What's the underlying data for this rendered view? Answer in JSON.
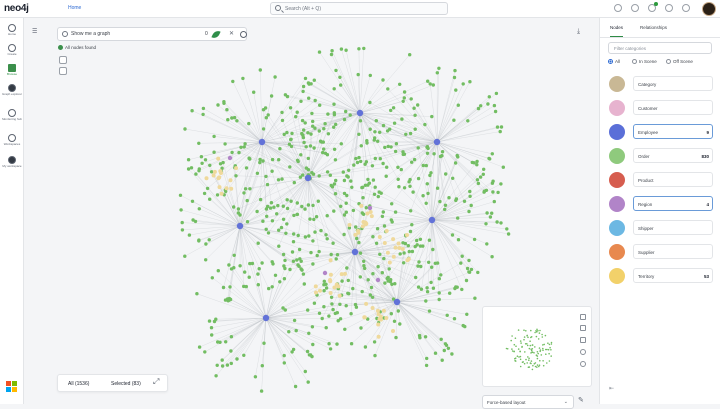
{
  "topbar": {
    "logo": "neo4j",
    "home": "Home",
    "search_placeholder": "Search (Alt + Q)",
    "icons": [
      "question-icon",
      "sync-icon",
      "bell-icon",
      "settings-icon",
      "help-icon"
    ]
  },
  "nav": {
    "items": [
      {
        "label": "Home",
        "icon": "home-icon"
      },
      {
        "label": "Create",
        "icon": "plus-icon"
      },
      {
        "label": "Browse",
        "icon": "folder-icon"
      },
      {
        "label": "Graph explorer",
        "icon": "graph-icon"
      },
      {
        "label": "Monitoring hub",
        "icon": "monitor-icon"
      },
      {
        "label": "Workspaces",
        "icon": "workspace-icon"
      },
      {
        "label": "My workspace",
        "icon": "avatar-icon"
      }
    ]
  },
  "toolbar": {
    "nl_query": "Show me a graph",
    "nl_count": "0",
    "found": "All nodes found"
  },
  "bottom": {
    "all": "All (1536)",
    "selected": "Selected (83)",
    "layout": "Force-based layout"
  },
  "panel": {
    "tabs": [
      "Nodes",
      "Relationships"
    ],
    "filter_placeholder": "Filter categories",
    "radios": [
      "All",
      "In Scene",
      "Off Scene"
    ],
    "categories": [
      {
        "label": "Category",
        "color": "#c9b895",
        "count": ""
      },
      {
        "label": "Customer",
        "color": "#e7b3cf",
        "count": ""
      },
      {
        "label": "Employee",
        "color": "#5b6fd8",
        "count": "9"
      },
      {
        "label": "Order",
        "color": "#8fca7d",
        "count": "830"
      },
      {
        "label": "Product",
        "color": "#d65d4f",
        "count": ""
      },
      {
        "label": "Region",
        "color": "#b184c8",
        "count": "4"
      },
      {
        "label": "Shipper",
        "color": "#6cb8e3",
        "count": ""
      },
      {
        "label": "Supplier",
        "color": "#e8894f",
        "count": ""
      },
      {
        "label": "Territory",
        "color": "#f2d16a",
        "count": "53"
      }
    ]
  },
  "graph_colors": {
    "order": "#72bd62",
    "employee": "#6272d8",
    "territory": "#efd99b",
    "region": "#b184c8",
    "edge": "#b9bdc4"
  }
}
